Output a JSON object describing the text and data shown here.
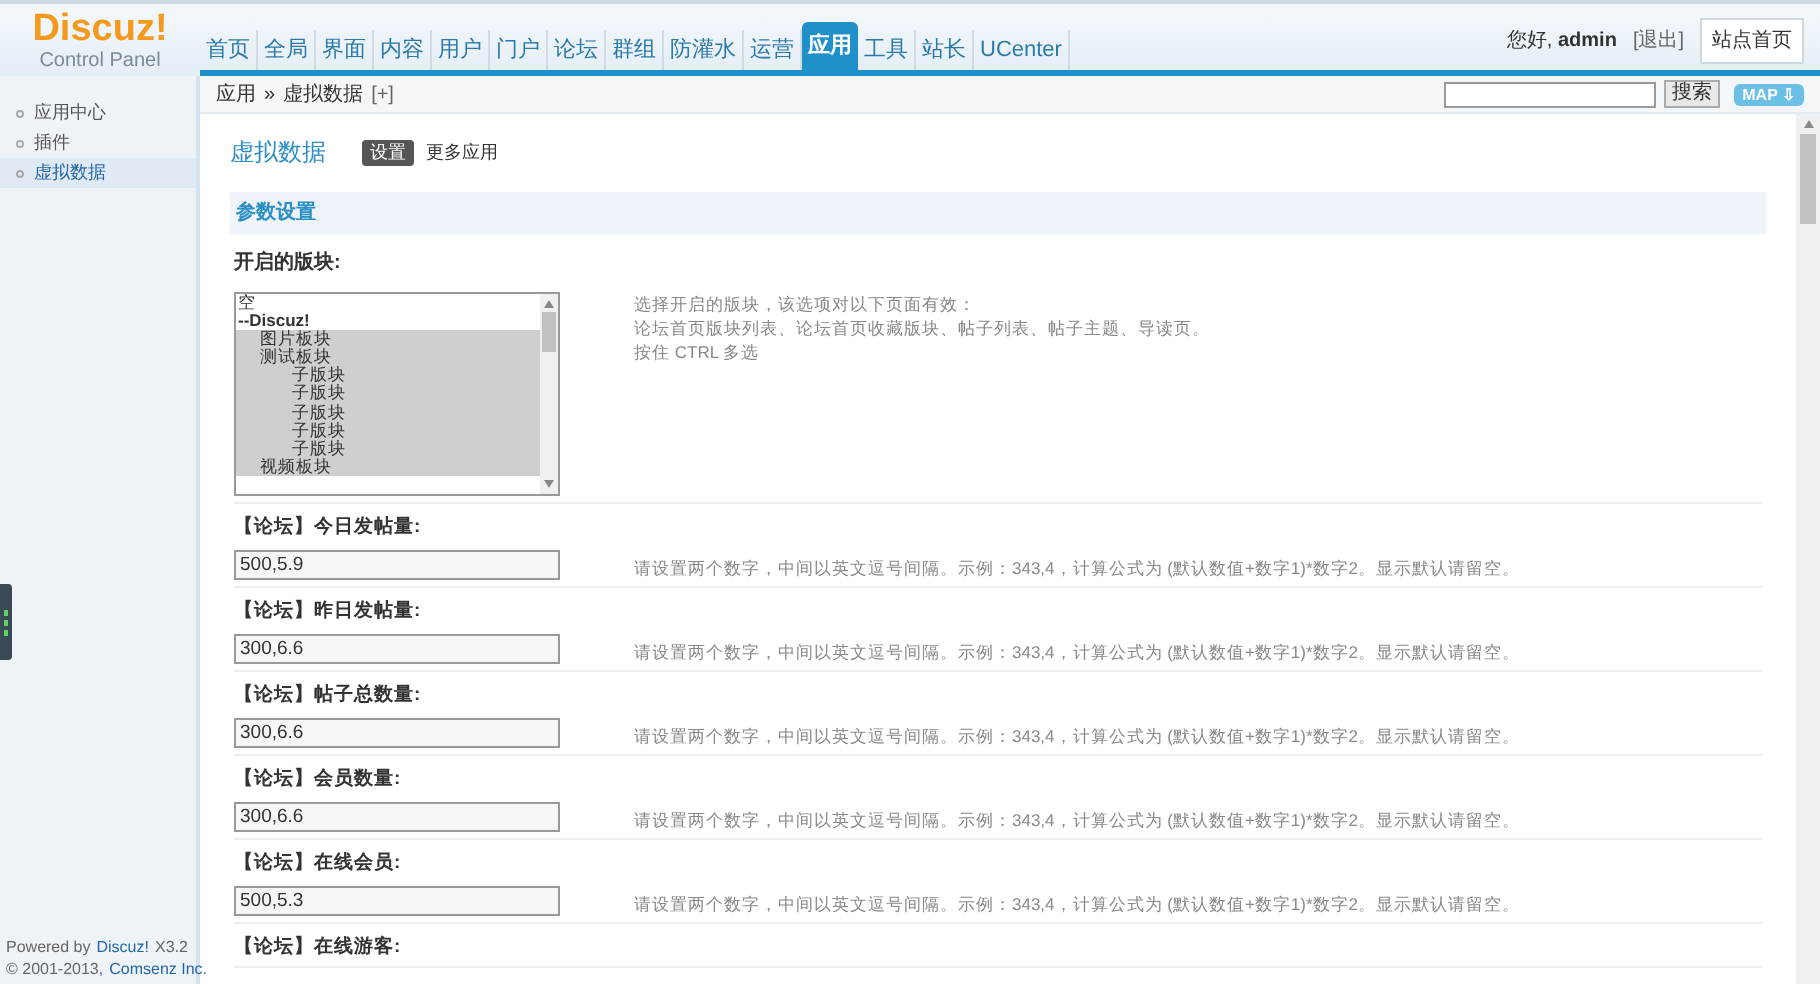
{
  "logo": {
    "title": "Discuz!",
    "subtitle": "Control Panel"
  },
  "nav": [
    {
      "label": "首页",
      "selected": false
    },
    {
      "label": "全局",
      "selected": false
    },
    {
      "label": "界面",
      "selected": false
    },
    {
      "label": "内容",
      "selected": false
    },
    {
      "label": "用户",
      "selected": false
    },
    {
      "label": "门户",
      "selected": false
    },
    {
      "label": "论坛",
      "selected": false
    },
    {
      "label": "群组",
      "selected": false
    },
    {
      "label": "防灌水",
      "selected": false
    },
    {
      "label": "运营",
      "selected": false
    },
    {
      "label": "应用",
      "selected": true
    },
    {
      "label": "工具",
      "selected": false
    },
    {
      "label": "站长",
      "selected": false
    },
    {
      "label": "UCenter",
      "selected": false
    }
  ],
  "user": {
    "greeting": "您好,",
    "name": "admin",
    "logout": "[退出]",
    "home_button": "站点首页"
  },
  "breadcrumb": {
    "path": "应用",
    "separator": "»",
    "current": "虚拟数据",
    "add": "[+]"
  },
  "search": {
    "button": "搜索",
    "map": "MAP ⇩"
  },
  "sidebar": {
    "items": [
      {
        "label": "应用中心",
        "selected": false
      },
      {
        "label": "插件",
        "selected": false
      },
      {
        "label": "虚拟数据",
        "selected": true
      }
    ],
    "footer": {
      "powered": "Powered by",
      "brand": "Discuz!",
      "version": "X3.2",
      "copyright": "© 2001-2013,",
      "company": "Comsenz Inc."
    }
  },
  "page": {
    "title": "虚拟数据",
    "tabs": [
      {
        "label": "设置",
        "selected": true
      },
      {
        "label": "更多应用",
        "selected": false
      }
    ],
    "section": "参数设置"
  },
  "forum_select": {
    "label": "开启的版块:",
    "options": [
      {
        "label": "空",
        "kind": "option",
        "selected": false
      },
      {
        "label": "--Discuz!",
        "kind": "group",
        "children": [
          {
            "label": "图片板块",
            "kind": "option",
            "selected": true
          },
          {
            "label": "测试板块",
            "kind": "option",
            "selected": true,
            "children": [
              {
                "label": "子版块",
                "kind": "option",
                "selected": true
              },
              {
                "label": "子版块",
                "kind": "option",
                "selected": true
              },
              {
                "label": "子版块",
                "kind": "option",
                "selected": true
              },
              {
                "label": "子版块",
                "kind": "option",
                "selected": true
              },
              {
                "label": "子版块",
                "kind": "option",
                "selected": true
              }
            ]
          },
          {
            "label": "视频板块",
            "kind": "option",
            "selected": true
          }
        ]
      }
    ],
    "help": [
      "选择开启的版块，该选项对以下页面有效：",
      "论坛首页版块列表、论坛首页收藏版块、帖子列表、帖子主题、导读页。",
      "按住 CTRL 多选"
    ]
  },
  "fields": [
    {
      "label": "【论坛】今日发帖量:",
      "value": "500,5.9",
      "help": "请设置两个数字，中间以英文逗号间隔。示例：343,4，计算公式为 (默认数值+数字1)*数字2。显示默认请留空。"
    },
    {
      "label": "【论坛】昨日发帖量:",
      "value": "300,6.6",
      "help": "请设置两个数字，中间以英文逗号间隔。示例：343,4，计算公式为 (默认数值+数字1)*数字2。显示默认请留空。"
    },
    {
      "label": "【论坛】帖子总数量:",
      "value": "300,6.6",
      "help": "请设置两个数字，中间以英文逗号间隔。示例：343,4，计算公式为 (默认数值+数字1)*数字2。显示默认请留空。"
    },
    {
      "label": "【论坛】会员数量:",
      "value": "300,6.6",
      "help": "请设置两个数字，中间以英文逗号间隔。示例：343,4，计算公式为 (默认数值+数字1)*数字2。显示默认请留空。"
    },
    {
      "label": "【论坛】在线会员:",
      "value": "500,5.3",
      "help": "请设置两个数字，中间以英文逗号间隔。示例：343,4，计算公式为 (默认数值+数字1)*数字2。显示默认请留空。"
    },
    {
      "label": "【论坛】在线游客:"
    }
  ]
}
